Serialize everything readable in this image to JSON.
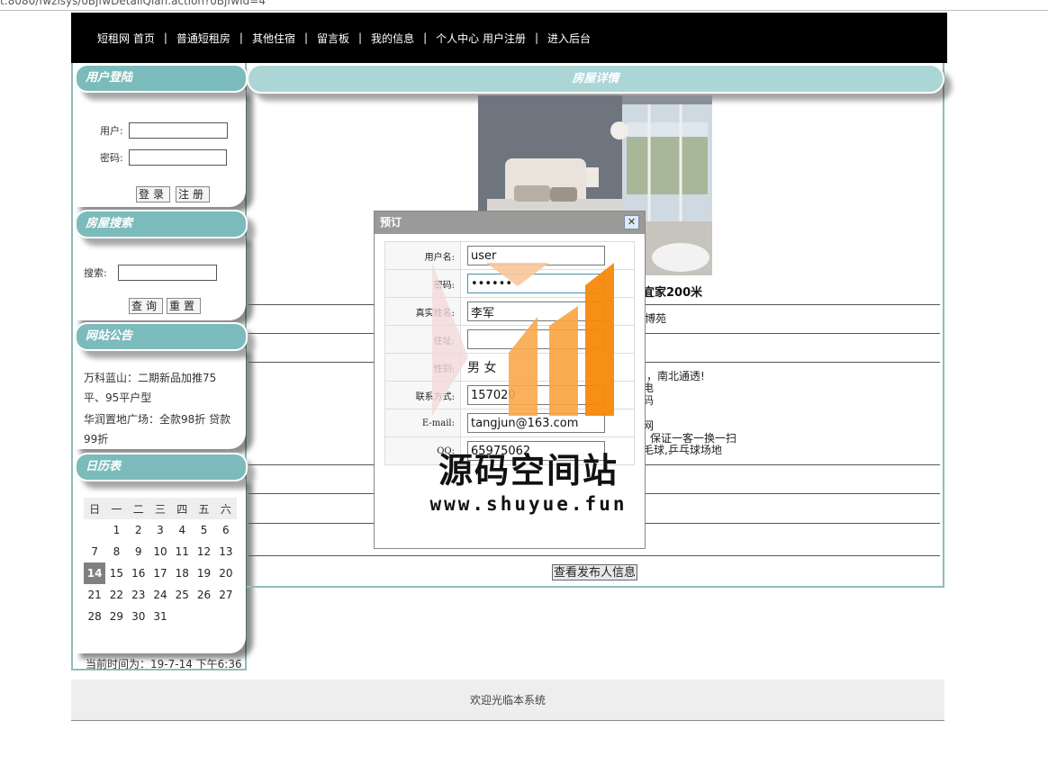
{
  "browser": {
    "url_fragment": "t:8080/fwzlsys/oBjfwDetailQian.action?oBjfwId=4"
  },
  "nav": {
    "items": [
      "短租网 首页",
      "普通短租房",
      "其他住宿",
      "留言板",
      "我的信息",
      "个人中心 用户注册",
      "进入后台"
    ],
    "separator": "|"
  },
  "login": {
    "title": "用户登陆",
    "user_label": "用户:",
    "pass_label": "密码:",
    "login_button": "登录",
    "register_button": "注册"
  },
  "search": {
    "title": "房屋搜索",
    "label": "搜索:",
    "query_button": "查询",
    "reset_button": "重置"
  },
  "notice": {
    "title": "网站公告",
    "items": [
      "万科蓝山：二期新品加推75平、95平户型",
      "华润置地广场：全款98折 贷款99折"
    ]
  },
  "calendar": {
    "title": "日历表",
    "weekdays": [
      "日",
      "一",
      "二",
      "三",
      "四",
      "五",
      "六"
    ],
    "weeks": [
      [
        "",
        "1",
        "2",
        "3",
        "4",
        "5",
        "6"
      ],
      [
        "7",
        "8",
        "9",
        "10",
        "11",
        "12",
        "13"
      ],
      [
        "14",
        "15",
        "16",
        "17",
        "18",
        "19",
        "20"
      ],
      [
        "21",
        "22",
        "23",
        "24",
        "25",
        "26",
        "27"
      ],
      [
        "28",
        "29",
        "30",
        "31",
        "",
        "",
        ""
      ]
    ],
    "today": "14",
    "current_time": "当前时间为：19-7-14 下午6:36"
  },
  "detail": {
    "title": "房屋详情",
    "house_title_fragment": "宜家200米",
    "line1": "湖博苑",
    "desc_lines": [
      "宫，南北通透!",
      "电",
      "码",
      "",
      "网",
      "，保证一客一换一扫",
      "毛球,乒乓球场地"
    ],
    "view_publisher_button": "查看发布人信息"
  },
  "dialog": {
    "title": "预订",
    "close": "✕",
    "fields": [
      {
        "label": "用户名:",
        "value": "user"
      },
      {
        "label": "密码:",
        "value": "••••••"
      },
      {
        "label": "真实姓名:",
        "value": "李军"
      },
      {
        "label": "住址:",
        "value": ""
      },
      {
        "label": "性别:",
        "value": "男 女"
      },
      {
        "label": "联系方式:",
        "value": "157020"
      },
      {
        "label": "E-mail:",
        "value": "tangjun@163.com"
      },
      {
        "label": "QQ:",
        "value": "65975062"
      }
    ]
  },
  "watermark": {
    "text": "源码空间站",
    "url": "www.shuyue.fun"
  },
  "footer": {
    "text": "欢迎光临本系统"
  },
  "colors": {
    "teal_head": "#7cbbbc",
    "teal_light": "#acd6d6",
    "nav_bg": "#000000",
    "footer_bg": "#eeeeee",
    "wm_orange": "#f7890a"
  }
}
